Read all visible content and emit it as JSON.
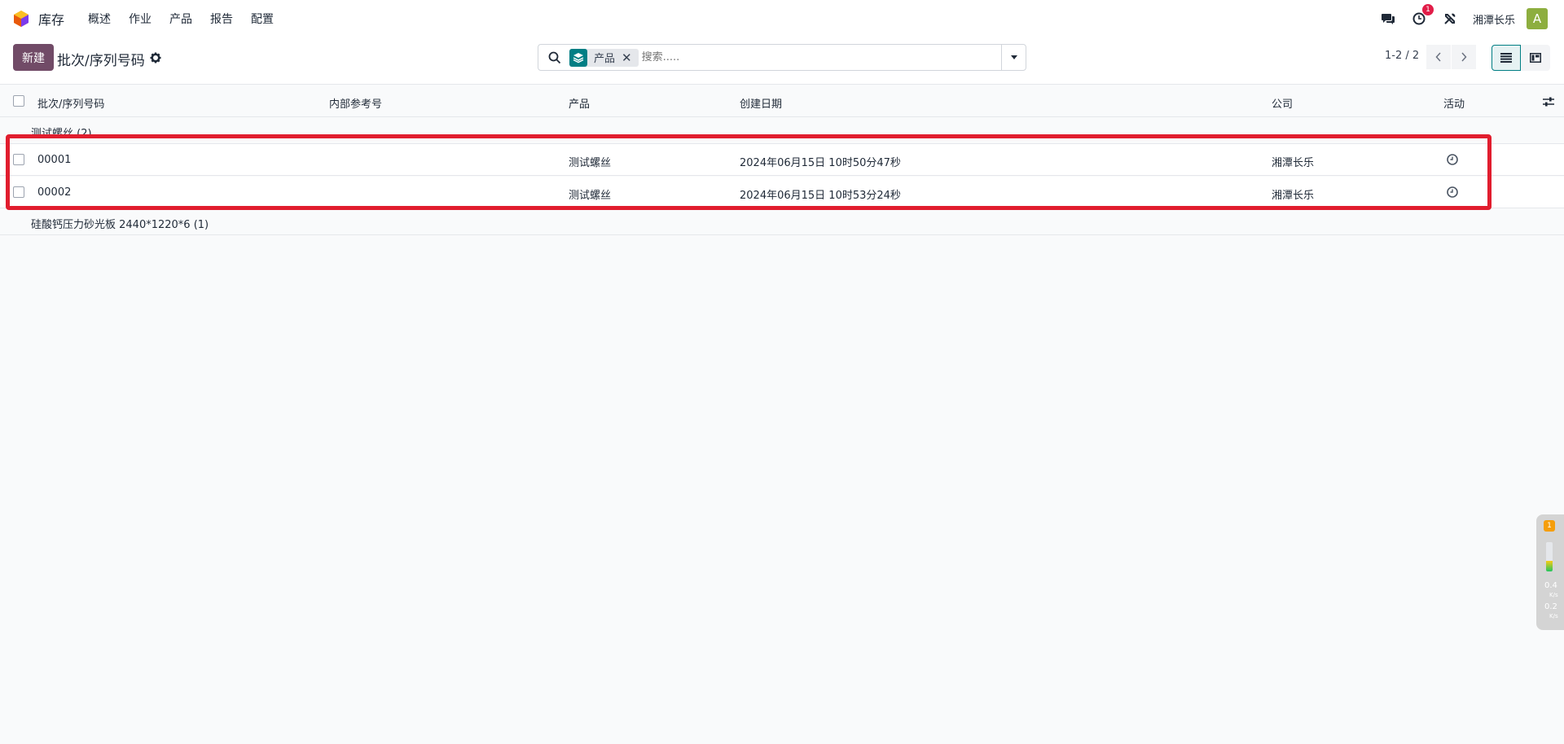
{
  "topnav": {
    "app_name": "库存",
    "menu": [
      "概述",
      "作业",
      "产品",
      "报告",
      "配置"
    ],
    "activity_count": "1",
    "company": "湘潭长乐",
    "avatar_letter": "A"
  },
  "control": {
    "new_label": "新建",
    "breadcrumb": "批次/序列号码",
    "facet_label": "产品",
    "search_placeholder": "搜索.....",
    "pager": "1-2 / 2"
  },
  "columns": [
    "批次/序列号码",
    "内部参考号",
    "产品",
    "创建日期",
    "公司",
    "活动"
  ],
  "groups": [
    {
      "label": "测试螺丝 (2)",
      "expanded": true,
      "rows": [
        {
          "lot": "00001",
          "ref": "",
          "product": "测试螺丝",
          "created": "2024年06月15日 10时50分47秒",
          "company": "湘潭长乐"
        },
        {
          "lot": "00002",
          "ref": "",
          "product": "测试螺丝",
          "created": "2024年06月15日 10时53分24秒",
          "company": "湘潭长乐"
        }
      ]
    },
    {
      "label": "硅酸钙压力砂光板 2440*1220*6 (1)",
      "expanded": false,
      "rows": []
    }
  ],
  "widget": {
    "badge": "1",
    "up_value": "0.4",
    "down_value": "0.2",
    "unit": "K/s",
    "level": 0.35
  },
  "colors": {
    "brand": "#714b67",
    "facet": "#017e84",
    "highlight": "#e11d2e",
    "avatar": "#8dae3f"
  }
}
